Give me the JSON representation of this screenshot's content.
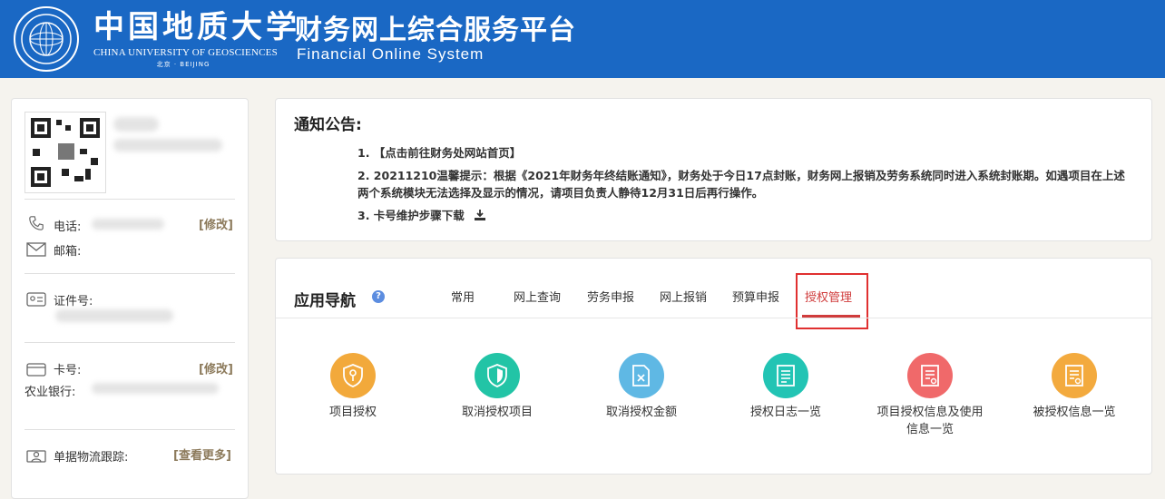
{
  "header": {
    "school_cn": "中国地质大学",
    "school_en": "CHINA UNIVERSITY OF GEOSCIENCES",
    "school_city": "北京 · BEIJING",
    "system_cn": "财务网上综合服务平台",
    "system_en": "Financial Online System"
  },
  "profile": {
    "phone_label": "电话:",
    "phone_edit": "[修改]",
    "email_label": "邮箱:",
    "id_label": "证件号:",
    "card_label": "卡号:",
    "card_edit": "[修改]",
    "bank_label": "农业银行:",
    "logistics_label": "单据物流跟踪:",
    "logistics_more": "[查看更多]"
  },
  "notice": {
    "title": "通知公告:",
    "items": [
      "1. 【点击前往财务处网站首页】",
      "2. 20211210温馨提示：根据《2021年财务年终结账通知》，财务处于今日17点封账，财务网上报销及劳务系统同时进入系统封账期。如遇项目在上述两个系统模块无法选择及显示的情况，请项目负责人静待12月31日后再行操作。",
      "3. 卡号维护步骤下载"
    ]
  },
  "nav": {
    "title": "应用导航",
    "help": "?",
    "tabs": [
      "常用",
      "网上查询",
      "劳务申报",
      "网上报销",
      "预算申报",
      "授权管理"
    ],
    "active_tab": "授权管理",
    "apps": [
      {
        "label": "项目授权",
        "color": "#f2a93b",
        "icon": "key-shield-icon"
      },
      {
        "label": "取消授权项目",
        "color": "#22c4a6",
        "icon": "shield-icon"
      },
      {
        "label": "取消授权金额",
        "color": "#5fb8e4",
        "icon": "document-cancel-icon"
      },
      {
        "label": "授权日志一览",
        "color": "#22c4b4",
        "icon": "log-list-icon"
      },
      {
        "label": "项目授权信息及使用信息一览",
        "color": "#f0696a",
        "icon": "info-list-icon"
      },
      {
        "label": "被授权信息一览",
        "color": "#f3aa3e",
        "icon": "received-list-icon"
      }
    ]
  }
}
